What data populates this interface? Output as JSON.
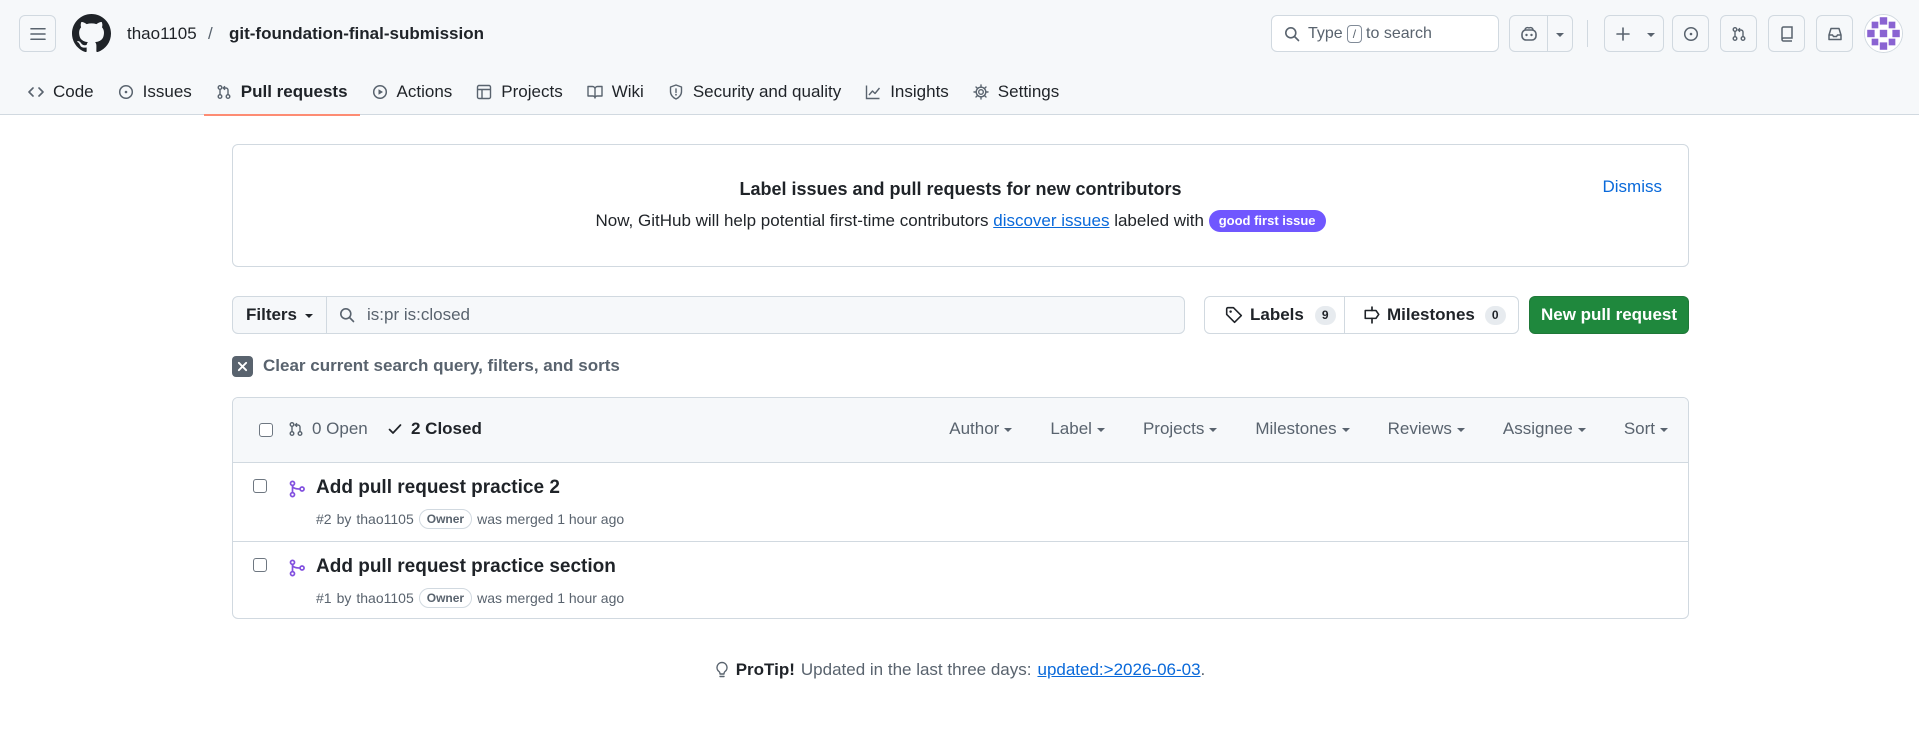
{
  "header": {
    "owner": "thao1105",
    "separator": "/",
    "repo": "git-foundation-final-submission",
    "search": {
      "prefix": "Type",
      "key": "/",
      "suffix": "to search"
    }
  },
  "nav": {
    "tabs": [
      {
        "label": "Code",
        "icon": "code-icon"
      },
      {
        "label": "Issues",
        "icon": "issue-opened-icon"
      },
      {
        "label": "Pull requests",
        "icon": "git-pull-request-icon",
        "active": true
      },
      {
        "label": "Actions",
        "icon": "play-icon"
      },
      {
        "label": "Projects",
        "icon": "table-icon"
      },
      {
        "label": "Wiki",
        "icon": "book-icon"
      },
      {
        "label": "Security and quality",
        "icon": "shield-icon"
      },
      {
        "label": "Insights",
        "icon": "graph-icon"
      },
      {
        "label": "Settings",
        "icon": "gear-icon"
      }
    ]
  },
  "banner": {
    "title": "Label issues and pull requests for new contributors",
    "text_before": "Now, GitHub will help potential first-time contributors",
    "link": "discover issues",
    "text_after": "labeled with",
    "badge": "good first issue",
    "badge_color": "#7057ff",
    "dismiss": "Dismiss"
  },
  "filters": {
    "button": "Filters",
    "query": "is:pr is:closed",
    "labels_label": "Labels",
    "labels_count": "9",
    "milestones_label": "Milestones",
    "milestones_count": "0",
    "new_pr": "New pull request",
    "new_pr_color": "#1f883d",
    "clear": "Clear current search query, filters, and sorts"
  },
  "list": {
    "open_label": "0 Open",
    "closed_label": "2 Closed",
    "header_filters": [
      "Author",
      "Label",
      "Projects",
      "Milestones",
      "Reviews",
      "Assignee",
      "Sort"
    ],
    "merged_color": "#8250df",
    "items": [
      {
        "title": "Add pull request practice 2",
        "number": "#2",
        "by": "by",
        "author": "thao1105",
        "role": "Owner",
        "status": "was merged 1 hour ago"
      },
      {
        "title": "Add pull request practice section",
        "number": "#1",
        "by": "by",
        "author": "thao1105",
        "role": "Owner",
        "status": "was merged 1 hour ago"
      }
    ]
  },
  "protip": {
    "label": "ProTip!",
    "text": "Updated in the last three days:",
    "link": "updated:>2026-06-03",
    "end": "."
  }
}
